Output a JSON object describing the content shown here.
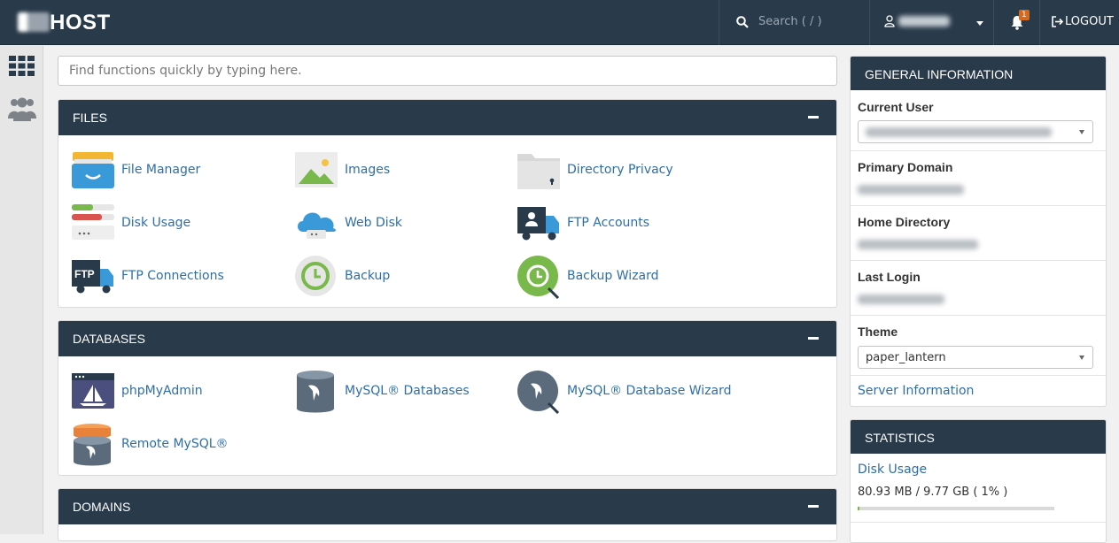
{
  "header": {
    "brand_suffix": "HOST",
    "search_placeholder": "Search ( / )",
    "notification_count": "1",
    "logout_label": "LOGOUT"
  },
  "find": {
    "placeholder": "Find functions quickly by typing here."
  },
  "sections": {
    "files": {
      "title": "FILES",
      "items": [
        "File Manager",
        "Images",
        "Directory Privacy",
        "Disk Usage",
        "Web Disk",
        "FTP Accounts",
        "FTP Connections",
        "Backup",
        "Backup Wizard"
      ]
    },
    "databases": {
      "title": "DATABASES",
      "items": [
        "phpMyAdmin",
        "MySQL® Databases",
        "MySQL® Database Wizard",
        "Remote MySQL®"
      ]
    },
    "domains": {
      "title": "DOMAINS"
    }
  },
  "general_info": {
    "title": "GENERAL INFORMATION",
    "current_user_label": "Current User",
    "primary_domain_label": "Primary Domain",
    "home_directory_label": "Home Directory",
    "last_login_label": "Last Login",
    "theme_label": "Theme",
    "theme_value": "paper_lantern",
    "server_info_link": "Server Information"
  },
  "statistics": {
    "title": "STATISTICS",
    "disk_usage_label": "Disk Usage",
    "disk_usage_value": "80.93 MB / 9.77 GB ( 1% )",
    "disk_usage_percent": 1
  },
  "colors": {
    "navy": "#293a4a",
    "link": "#2e6ea6",
    "badge": "#d2691e"
  }
}
